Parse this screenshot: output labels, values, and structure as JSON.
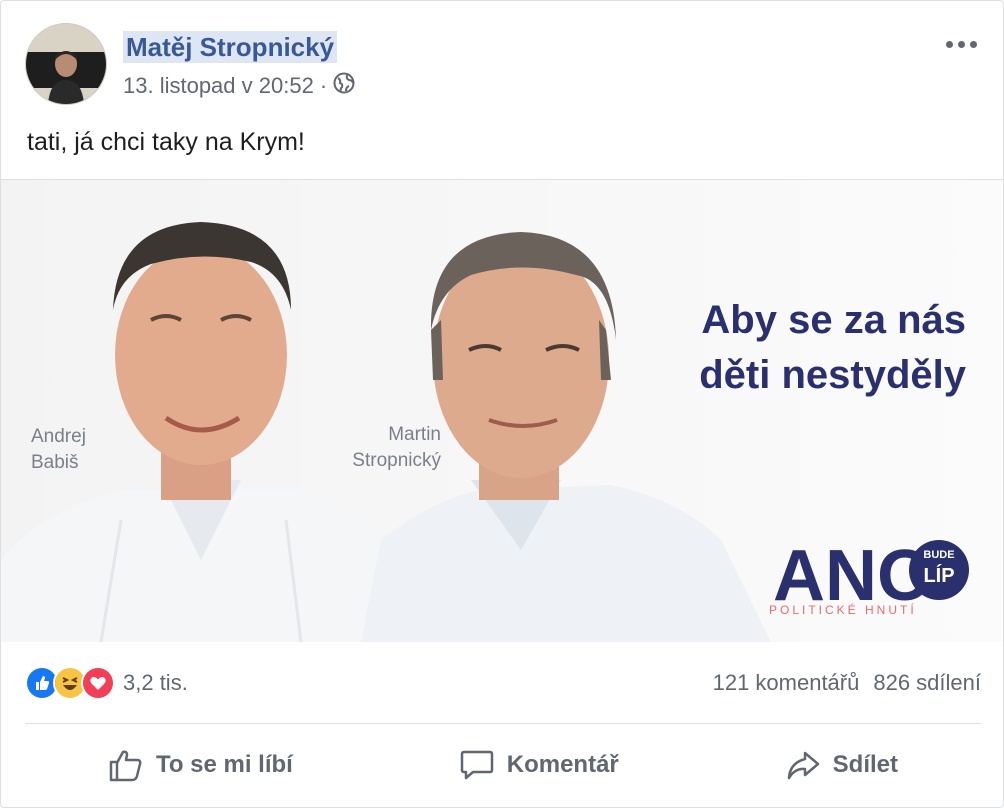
{
  "post": {
    "author": "Matěj Stropnický",
    "timestamp": "13. listopad v 20:52",
    "separator": "·",
    "text": "tati, já chci taky na Krym!"
  },
  "image": {
    "slogan_line1": "Aby se za nás",
    "slogan_line2": "děti nestyděly",
    "person1_first": "Andrej",
    "person1_last": "Babiš",
    "person2_first": "Martin",
    "person2_last": "Stropnický",
    "logo_main": "ANO",
    "logo_badge_top": "BUDE",
    "logo_badge_bottom": "LÍP",
    "logo_sub": "POLITICKÉ HNUTÍ"
  },
  "stats": {
    "reactions_count": "3,2 tis.",
    "comments": "121 komentářů",
    "shares": "826 sdílení"
  },
  "actions": {
    "like": "To se mi líbí",
    "comment": "Komentář",
    "share": "Sdílet"
  },
  "colors": {
    "link": "#385898",
    "like_blue": "#1877f2",
    "haha_yellow": "#f7c444",
    "love_red": "#f33e58",
    "ano_navy": "#2a2f6e"
  }
}
